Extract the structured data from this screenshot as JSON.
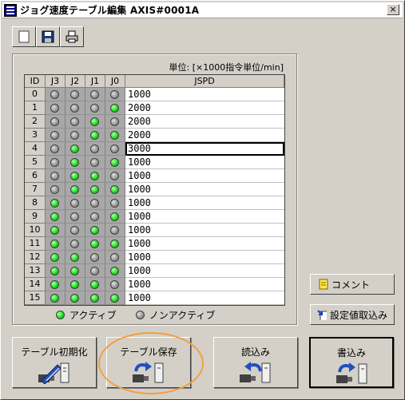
{
  "window": {
    "title": "ジョグ速度テーブル編集  AXIS#0001A",
    "close": "×"
  },
  "toolbar": [
    {
      "name": "new-icon"
    },
    {
      "name": "save-icon"
    },
    {
      "name": "print-icon"
    }
  ],
  "table": {
    "unit_label": "単位: [×1000指令単位/min]",
    "headers": [
      "ID",
      "J3",
      "J2",
      "J1",
      "J0",
      "JSPD"
    ],
    "selected_row": 4,
    "rows": [
      {
        "id": "0",
        "j": [
          0,
          0,
          0,
          0
        ],
        "jspd": "1000"
      },
      {
        "id": "1",
        "j": [
          0,
          0,
          0,
          1
        ],
        "jspd": "2000"
      },
      {
        "id": "2",
        "j": [
          0,
          0,
          1,
          0
        ],
        "jspd": "2000"
      },
      {
        "id": "3",
        "j": [
          0,
          0,
          1,
          1
        ],
        "jspd": "2000"
      },
      {
        "id": "4",
        "j": [
          0,
          1,
          0,
          0
        ],
        "jspd": "3000"
      },
      {
        "id": "5",
        "j": [
          0,
          1,
          0,
          1
        ],
        "jspd": "1000"
      },
      {
        "id": "6",
        "j": [
          0,
          1,
          1,
          0
        ],
        "jspd": "1000"
      },
      {
        "id": "7",
        "j": [
          0,
          1,
          1,
          1
        ],
        "jspd": "1000"
      },
      {
        "id": "8",
        "j": [
          1,
          0,
          0,
          0
        ],
        "jspd": "1000"
      },
      {
        "id": "9",
        "j": [
          1,
          0,
          0,
          1
        ],
        "jspd": "1000"
      },
      {
        "id": "10",
        "j": [
          1,
          0,
          1,
          0
        ],
        "jspd": "1000"
      },
      {
        "id": "11",
        "j": [
          1,
          0,
          1,
          1
        ],
        "jspd": "1000"
      },
      {
        "id": "12",
        "j": [
          1,
          1,
          0,
          0
        ],
        "jspd": "1000"
      },
      {
        "id": "13",
        "j": [
          1,
          1,
          0,
          1
        ],
        "jspd": "1000"
      },
      {
        "id": "14",
        "j": [
          1,
          1,
          1,
          0
        ],
        "jspd": "1000"
      },
      {
        "id": "15",
        "j": [
          1,
          1,
          1,
          1
        ],
        "jspd": "1000"
      }
    ]
  },
  "legend": {
    "active": "アクティブ",
    "inactive": "ノンアクティブ"
  },
  "side_buttons": {
    "comment": "コメント",
    "import_settings": "設定値取込み"
  },
  "bottom_buttons": {
    "init": "テーブル初期化",
    "save": "テーブル保存",
    "read": "読込み",
    "write": "書込み"
  },
  "colors": {
    "active_led": "#19e019",
    "inactive_led": "#9a9a9a",
    "highlight": "#f0a040"
  }
}
